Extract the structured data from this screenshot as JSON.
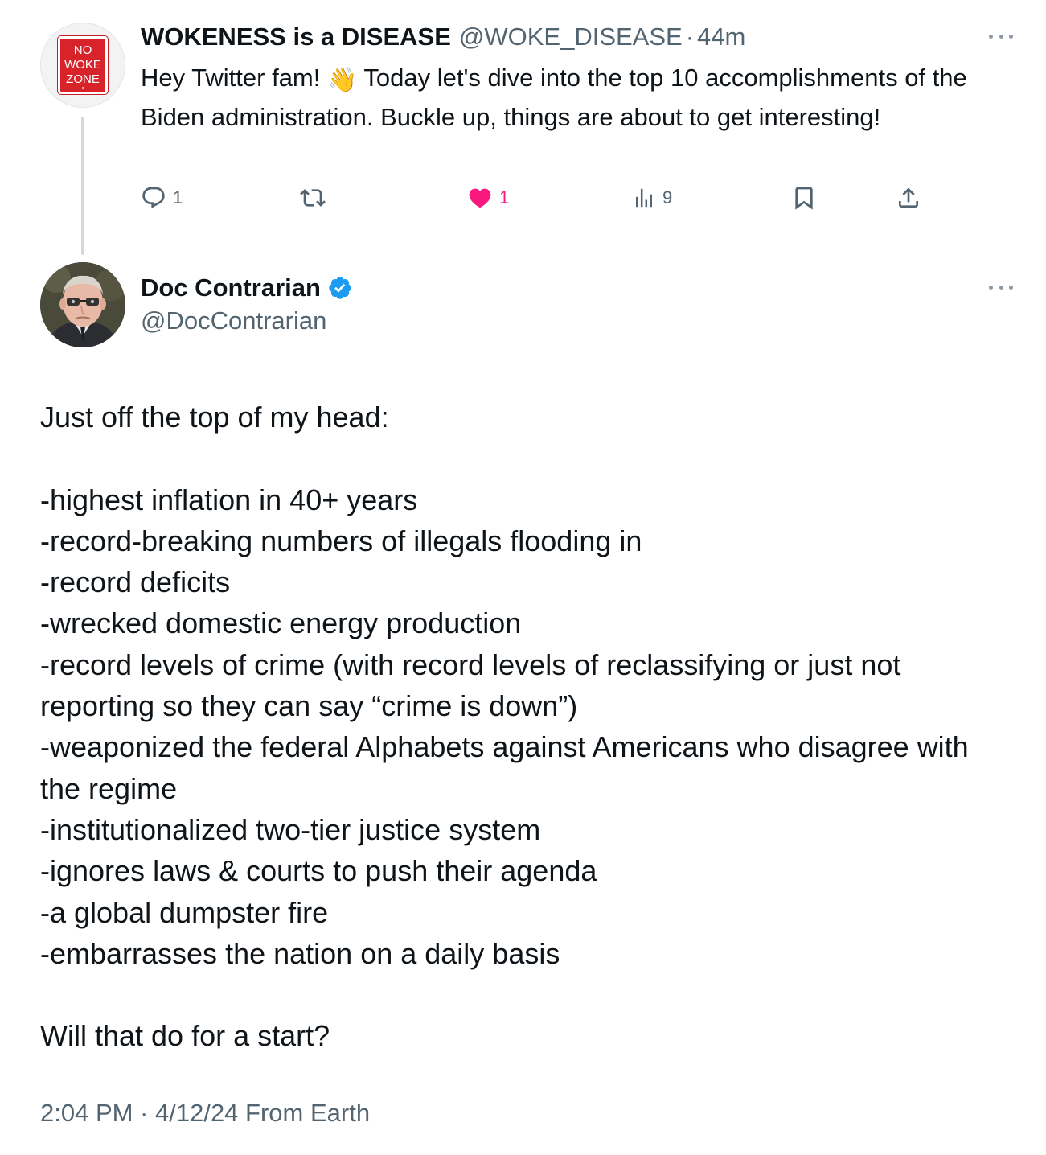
{
  "parent_tweet": {
    "author_name": "WOKENESS is a DISEASE",
    "handle": "@WOKE_DISEASE",
    "separator": "·",
    "time": "44m",
    "avatar_sign": [
      "NO",
      "WOKE",
      "ZONE"
    ],
    "text_before_emoji": "Hey Twitter fam! ",
    "emoji": "👋",
    "text_after_emoji": " Today let's dive into the top 10 accomplishments of the Biden administration. Buckle up, things are about to get interesting!",
    "reply_count": "1",
    "retweet_count": "",
    "like_count": "1",
    "view_count": "9",
    "liked": true
  },
  "main_tweet": {
    "author_name": "Doc Contrarian",
    "verified": true,
    "handle": "@DocContrarian",
    "body": "Just off the top of my head:\n\n-highest inflation in 40+ years\n-record-breaking numbers of illegals flooding in\n-record deficits\n-wrecked domestic energy production\n-record levels of crime (with record levels of reclassifying or just not reporting so they can say “crime is down”)\n-weaponized the federal Alphabets against Americans who disagree with the regime\n-institutionalized two-tier justice system\n-ignores laws & courts to push their agenda\n-a global dumpster fire\n-embarrasses the nation on a daily basis\n\nWill that do for a start?",
    "meta": "2:04 PM · 4/12/24 From Earth"
  },
  "icons": {
    "reply": "reply-icon",
    "retweet": "retweet-icon",
    "like": "heart-icon",
    "views": "views-icon",
    "bookmark": "bookmark-icon",
    "share": "share-icon",
    "more": "more-icon",
    "verified": "verified-badge-icon"
  },
  "colors": {
    "text": "#0f1419",
    "secondary": "#536471",
    "like_pink": "#f91880",
    "verified_blue": "#1d9bf0",
    "sign_red": "#d8232a"
  }
}
